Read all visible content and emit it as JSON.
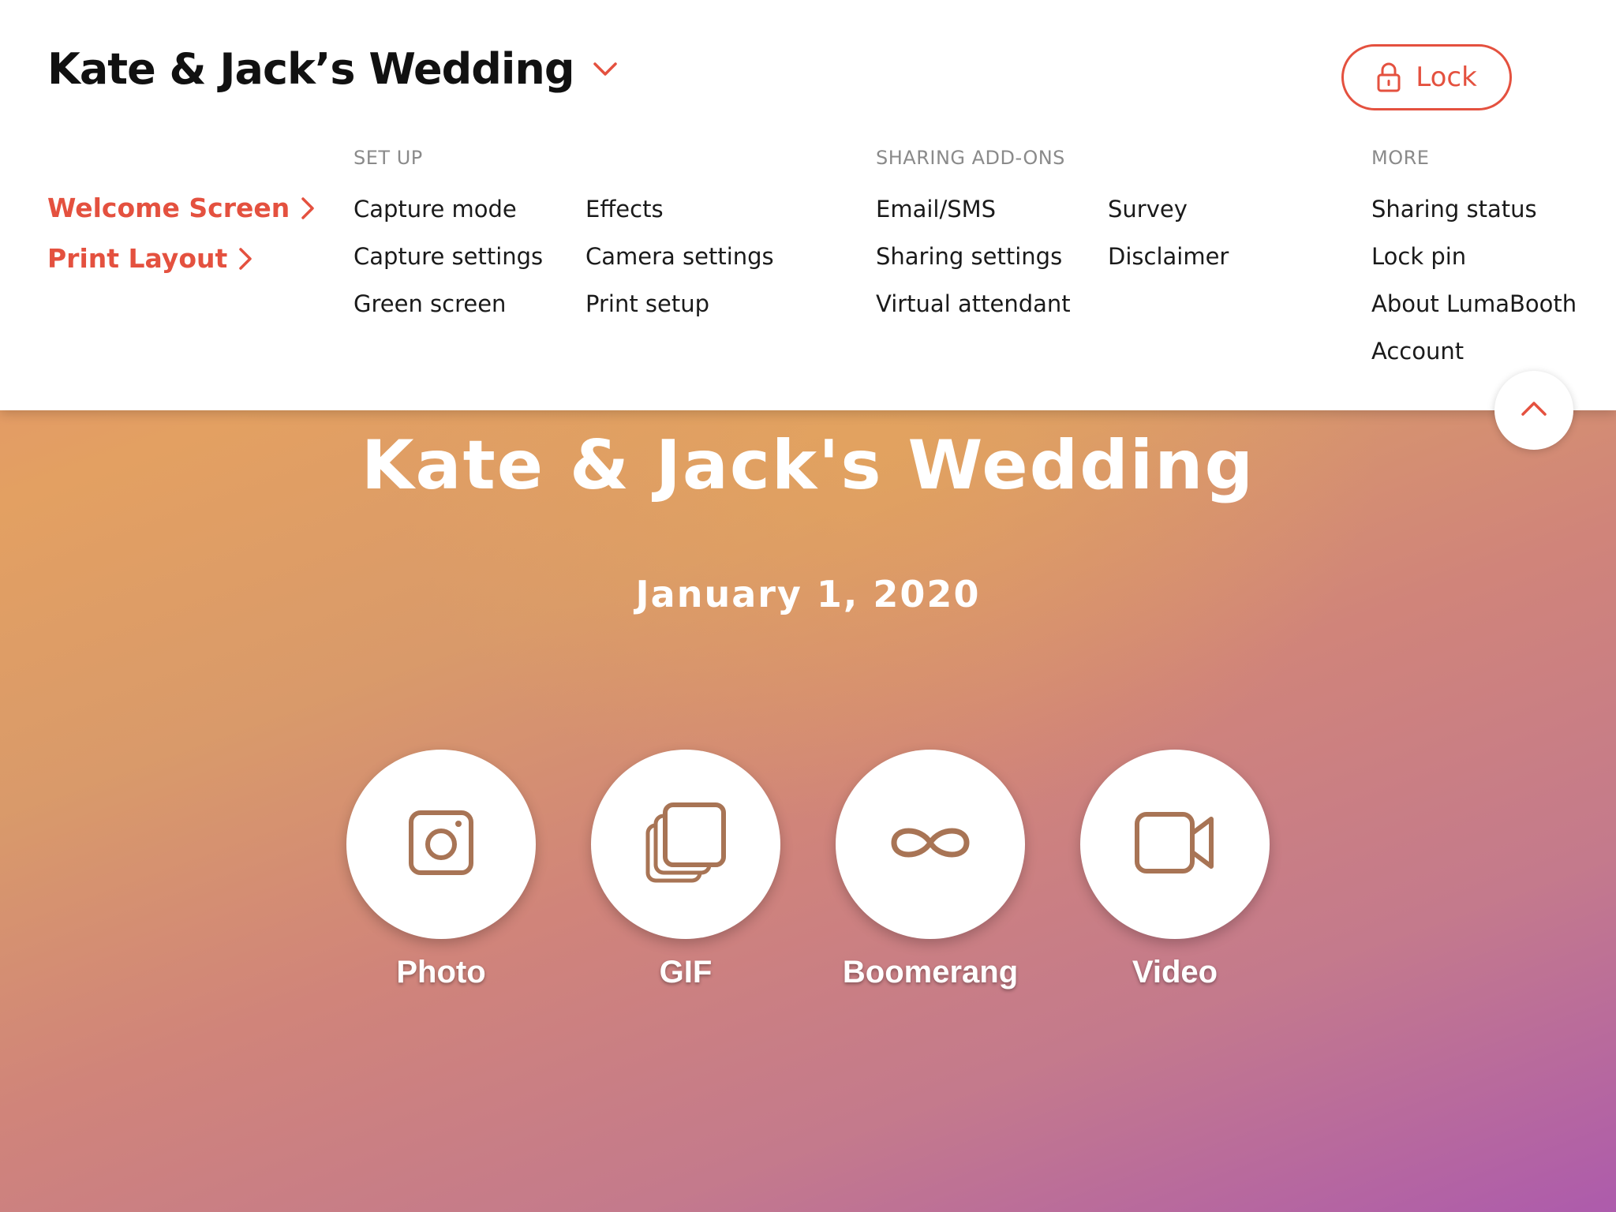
{
  "header": {
    "event_title": "Kate & Jack’s Wedding",
    "lock_label": "Lock"
  },
  "nav": {
    "welcome_screen": "Welcome Screen",
    "print_layout": "Print Layout"
  },
  "sections": {
    "setup": {
      "heading": "SET UP",
      "col1": [
        "Capture mode",
        "Capture settings",
        "Green screen"
      ],
      "col2": [
        "Effects",
        "Camera settings",
        "Print setup"
      ]
    },
    "sharing": {
      "heading": "SHARING ADD-ONS",
      "col1": [
        "Email/SMS",
        "Sharing settings",
        "Virtual attendant"
      ],
      "col2": [
        "Survey",
        "Disclaimer"
      ]
    },
    "more": {
      "heading": "MORE",
      "items": [
        "Sharing status",
        "Lock pin",
        "About LumaBooth",
        "Account"
      ]
    }
  },
  "welcome": {
    "title": "Kate & Jack's Wedding",
    "date": "January 1, 2020",
    "modes": [
      {
        "label": "Photo",
        "icon": "camera-icon"
      },
      {
        "label": "GIF",
        "icon": "stacked-frames-icon"
      },
      {
        "label": "Boomerang",
        "icon": "infinity-icon"
      },
      {
        "label": "Video",
        "icon": "video-camera-icon"
      }
    ]
  },
  "colors": {
    "accent": "#e4513f",
    "icon_brown": "#a87455"
  }
}
